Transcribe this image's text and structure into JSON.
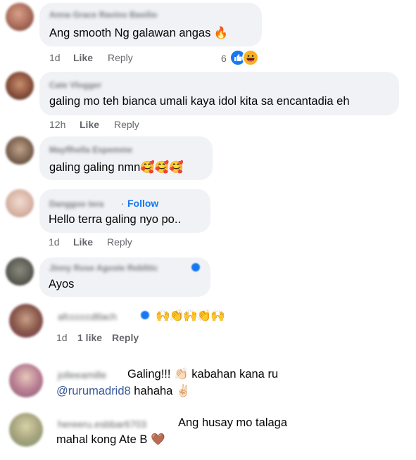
{
  "comments": [
    {
      "author": "Anna Grace Ravino Basilio",
      "text": "Ang smooth Ng galawan angas",
      "text_emoji": "🔥",
      "time": "1d",
      "like": "Like",
      "reply": "Reply",
      "reaction_count": "6",
      "reactions": [
        "like-icon",
        "haha-icon"
      ]
    },
    {
      "author": "Cate Vlogger",
      "text": "galing mo teh bianca umali kaya idol kita sa encantadia eh",
      "time": "12h",
      "like": "Like",
      "reply": "Reply"
    },
    {
      "author": "Mayflhella Espemme",
      "text": "galing galing nmn",
      "text_emoji": "🥰🥰🥰"
    },
    {
      "author": "Danggoo tera",
      "separator": "·",
      "follow": "Follow",
      "text": "Hello terra galing nyo po..",
      "time": "1d",
      "like": "Like",
      "reply": "Reply"
    },
    {
      "author": "Jinny Rose Agoste Reblitic",
      "text": "Ayos"
    },
    {
      "author": "afcccccdtlach",
      "text_emoji": "🙌👏🙌👏🙌",
      "time": "1d",
      "likes": "1 like",
      "reply": "Reply"
    },
    {
      "author": "jolleeamille",
      "text": "Galing!!!",
      "text_emoji": "👏🏻",
      "text_cont": "kabahan kana ru",
      "mention": "@rurumadrid8",
      "text_tail": "hahaha",
      "tail_emoji": "✌🏻"
    },
    {
      "author": "hereeru.esbbar6703",
      "text": "Ang husay mo talaga",
      "text_line2": "mahal kong Ate B",
      "tail_emoji": "🤎"
    }
  ]
}
